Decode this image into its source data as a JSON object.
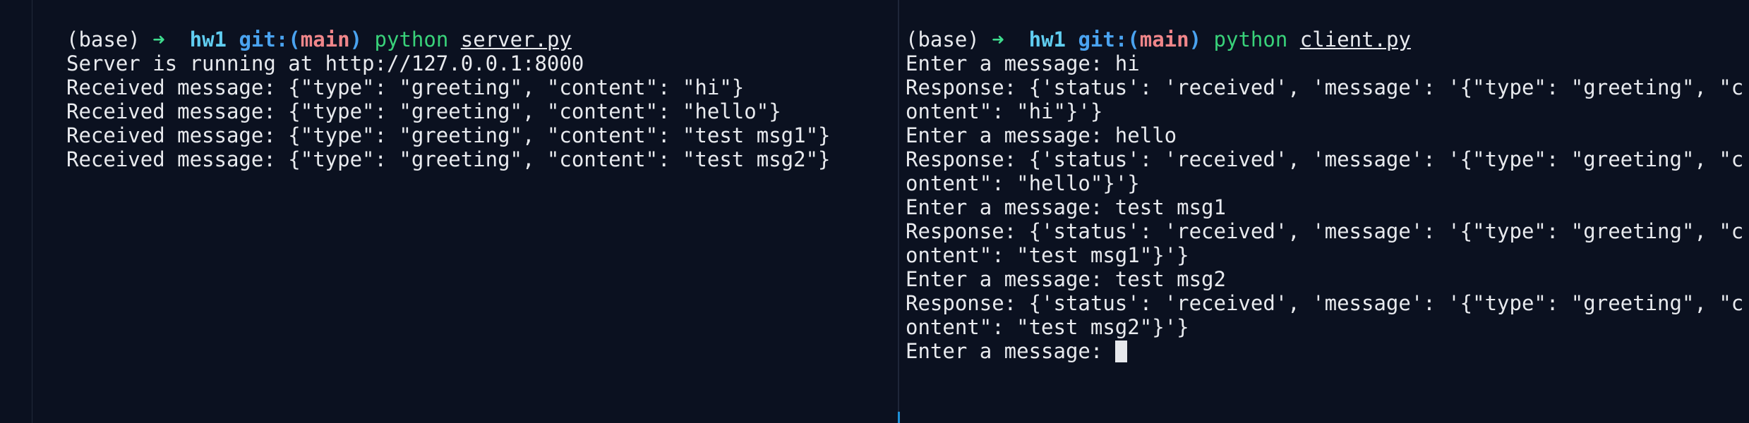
{
  "left_pane": {
    "prompt": {
      "env": "(base) ",
      "arrow": "➜",
      "dir": "  hw1 ",
      "git_label": "git:(",
      "branch": "main",
      "git_close": ")",
      "command": " python ",
      "argument": "server.py"
    },
    "output": [
      "Server is running at http://127.0.0.1:8000",
      "Received message: {\"type\": \"greeting\", \"content\": \"hi\"}",
      "Received message: {\"type\": \"greeting\", \"content\": \"hello\"}",
      "Received message: {\"type\": \"greeting\", \"content\": \"test msg1\"}",
      "Received message: {\"type\": \"greeting\", \"content\": \"test msg2\"}"
    ]
  },
  "right_pane": {
    "prompt": {
      "env": "(base) ",
      "arrow": "➜",
      "dir": "  hw1 ",
      "git_label": "git:(",
      "branch": "main",
      "git_close": ")",
      "command": " python ",
      "argument": "client.py"
    },
    "output": [
      "Enter a message: hi",
      "Response: {'status': 'received', 'message': '{\"type\": \"greeting\", \"c",
      "ontent\": \"hi\"}'}",
      "Enter a message: hello",
      "Response: {'status': 'received', 'message': '{\"type\": \"greeting\", \"c",
      "ontent\": \"hello\"}'}",
      "Enter a message: test msg1",
      "Response: {'status': 'received', 'message': '{\"type\": \"greeting\", \"c",
      "ontent\": \"test msg1\"}'}",
      "Enter a message: test msg2",
      "Response: {'status': 'received', 'message': '{\"type\": \"greeting\", \"c",
      "ontent\": \"test msg2\"}'}"
    ],
    "input_prompt": "Enter a message: "
  },
  "colors": {
    "background": "#0b1120",
    "text": "#e8eaee",
    "arrow": "#3fdc8e",
    "dir": "#60cdf0",
    "git": "#4aa3f0",
    "branch": "#f0868a",
    "command": "#39d27a",
    "active_pane_marker": "#1e90d6"
  }
}
